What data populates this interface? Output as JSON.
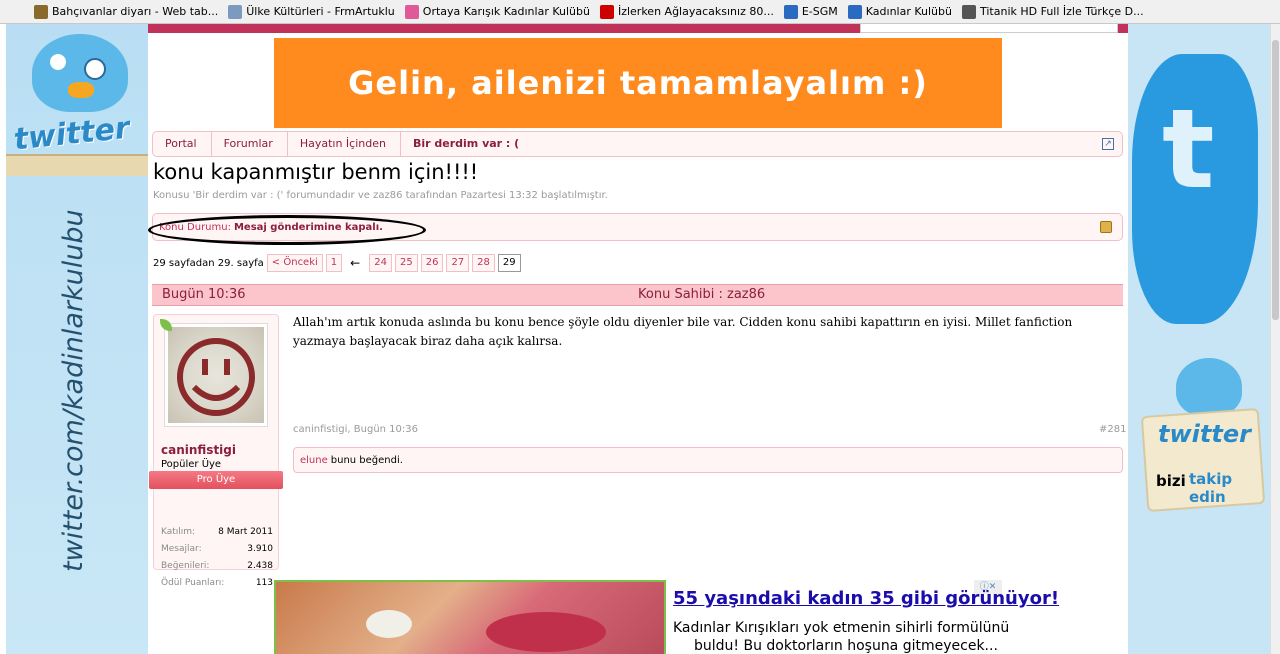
{
  "bookmarks": [
    {
      "label": "Bahçıvanlar diyarı - Web tab...",
      "color": "#8a6a2a"
    },
    {
      "label": "Ülke Kültürleri - FrmArtuklu",
      "color": "#7a9ac0"
    },
    {
      "label": "Ortaya Karışık  Kadınlar Kulübü",
      "color": "#e05a9a"
    },
    {
      "label": "İzlerken Ağlayacaksınız 80...",
      "color": "#cc0000"
    },
    {
      "label": "E-SGM",
      "color": "#2a6ac0"
    },
    {
      "label": "Kadınlar Kulübü",
      "color": "#2a6ac0"
    },
    {
      "label": "Titanik HD Full İzle Türkçe D...",
      "color": "#555555"
    }
  ],
  "banner": {
    "text": "Gelin, ailenizi tamamlayalım :)",
    "color": "#ff8a1e"
  },
  "breadcrumb": [
    "Portal",
    "Forumlar",
    "Hayatın İçinden",
    "Bir derdim var : ("
  ],
  "thread": {
    "title": "konu kapanmıştır benm için!!!!",
    "description": "Konusu 'Bir derdim var : (' forumundadır ve zaz86 tarafından Pazartesi 13:32 başlatılmıştır."
  },
  "status": {
    "label": "Konu Durumu:",
    "value": "Mesaj gönderimine kapalı."
  },
  "pagination": {
    "summary": "29 sayfadan 29. sayfa",
    "prev_label": "< Önceki",
    "first": "1",
    "arrow": "←",
    "pages": [
      "24",
      "25",
      "26",
      "27",
      "28"
    ],
    "current": "29"
  },
  "post": {
    "date": "Bugün 10:36",
    "owner_label": "Konu Sahibi : zaz86",
    "body": "Allah'ım artık konuda aslında bu konu bence şöyle oldu diyenler bile var. Cidden konu sahibi kapattırın en iyisi. Millet fanfiction yazmaya başlayacak biraz daha açık kalırsa.",
    "meta": "caninfistigi, Bugün 10:36",
    "number": "#281",
    "likes_user": "elune",
    "likes_text": "bunu beğendi."
  },
  "author": {
    "name": "caninfistigi",
    "title": "Popüler Üye",
    "rank": "Pro Üye",
    "stats": [
      {
        "label": "Katılım:",
        "value": "8 Mart 2011"
      },
      {
        "label": "Mesajlar:",
        "value": "3.910"
      },
      {
        "label": "Beğenileri:",
        "value": "2.438"
      },
      {
        "label": "Ödül Puanları:",
        "value": "113"
      }
    ]
  },
  "ad": {
    "headline": "55 yaşındaki kadın 35 gibi görünüyor!",
    "line1": "Kadınlar Kırışıkları yok etmenin sihirli formülünü",
    "line2": "buldu! Bu doktorların hoşuna gitmeyecek..."
  },
  "left_promo": {
    "logo": "twitter",
    "vertical": "twitter.com/kadinlarkulubu"
  },
  "right_promo": {
    "logo": "twitter",
    "t_letter": "t",
    "follow_a": "bizi",
    "follow_b": "takip edin"
  }
}
